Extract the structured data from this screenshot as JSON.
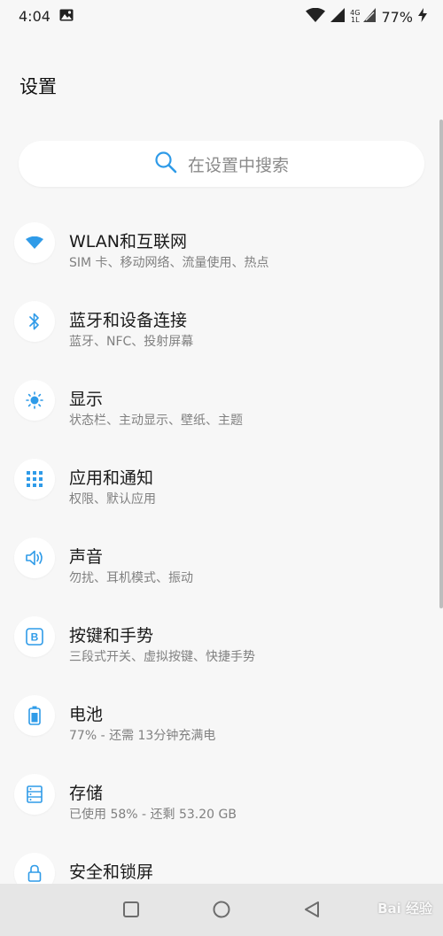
{
  "status_bar": {
    "time": "4:04",
    "battery_percent": "77%",
    "network_top": "4G",
    "network_bottom": "1L"
  },
  "page": {
    "title": "设置"
  },
  "search": {
    "placeholder": "在设置中搜索"
  },
  "settings_items": [
    {
      "title": "WLAN和互联网",
      "subtitle": "SIM 卡、移动网络、流量使用、热点",
      "icon": "wifi-icon"
    },
    {
      "title": "蓝牙和设备连接",
      "subtitle": "蓝牙、NFC、投射屏幕",
      "icon": "bluetooth-icon"
    },
    {
      "title": "显示",
      "subtitle": "状态栏、主动显示、壁纸、主题",
      "icon": "brightness-icon"
    },
    {
      "title": "应用和通知",
      "subtitle": "权限、默认应用",
      "icon": "apps-grid-icon"
    },
    {
      "title": "声音",
      "subtitle": "勿扰、耳机模式、振动",
      "icon": "speaker-icon"
    },
    {
      "title": "按键和手势",
      "subtitle": "三段式开关、虚拟按键、快捷手势",
      "icon": "button-b-icon"
    },
    {
      "title": "电池",
      "subtitle": "77% - 还需 13分钟充满电",
      "icon": "battery-icon"
    },
    {
      "title": "存储",
      "subtitle": "已使用 58% - 还剩 53.20 GB",
      "icon": "storage-icon"
    },
    {
      "title": "安全和锁屏",
      "subtitle": "",
      "icon": "lock-icon"
    }
  ],
  "colors": {
    "accent": "#2f9be8",
    "background": "#f7f7f7",
    "nav_bar": "#e6e6e6"
  },
  "watermark": {
    "text": "Bai 经验"
  }
}
